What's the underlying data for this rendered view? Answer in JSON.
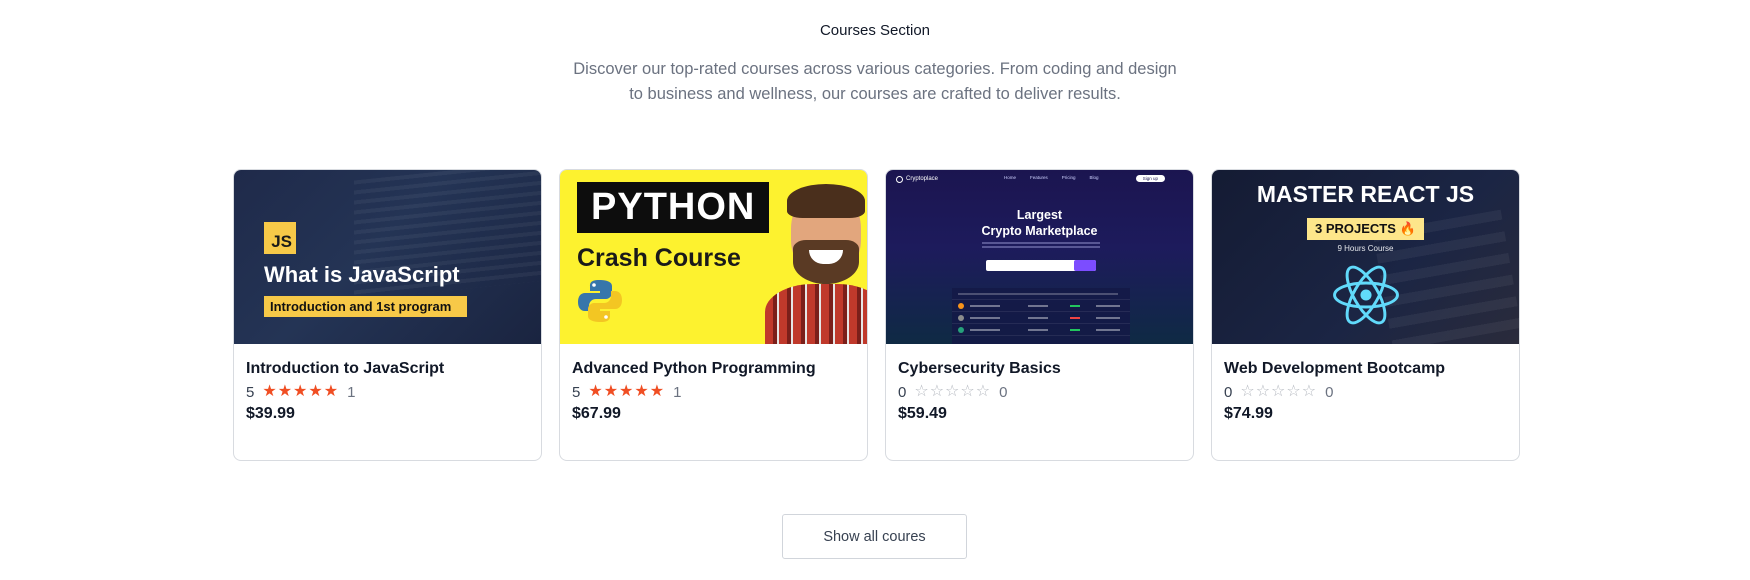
{
  "section": {
    "title": "Courses Section",
    "description": "Discover our top-rated courses across various categories. From coding and design to business and wellness, our courses are crafted to deliver results."
  },
  "courses": [
    {
      "title": "Introduction to JavaScript",
      "rating": "5",
      "stars_filled": 5,
      "reviews": "1",
      "price": "$39.99",
      "thumbnail": {
        "badge": "JS",
        "headline": "What is JavaScript",
        "subtitle": "Introduction and 1st program"
      }
    },
    {
      "title": "Advanced Python Programming",
      "rating": "5",
      "stars_filled": 5,
      "reviews": "1",
      "price": "$67.99",
      "thumbnail": {
        "headline": "PYTHON",
        "subtitle": "Crash Course"
      }
    },
    {
      "title": "Cybersecurity Basics",
      "rating": "0",
      "stars_filled": 0,
      "reviews": "0",
      "price": "$59.49",
      "thumbnail": {
        "logo": "Cryptoplace",
        "headline_line1": "Largest",
        "headline_line2": "Crypto Marketplace",
        "nav": [
          "Home",
          "Features",
          "Pricing",
          "Blog"
        ],
        "button": "Sign up"
      }
    },
    {
      "title": "Web Development Bootcamp",
      "rating": "0",
      "stars_filled": 0,
      "reviews": "0",
      "price": "$74.99",
      "thumbnail": {
        "headline": "MASTER REACT JS",
        "badge": "3 PROJECTS 🔥",
        "subtitle": "9 Hours Course"
      }
    }
  ],
  "actions": {
    "show_all_label": "Show all coures"
  },
  "colors": {
    "star": "#f04e23",
    "star_empty": "#b5b9c0",
    "python_yellow": "#fdf22f",
    "js_yellow": "#f7c948",
    "react_blue": "#61dafb"
  }
}
